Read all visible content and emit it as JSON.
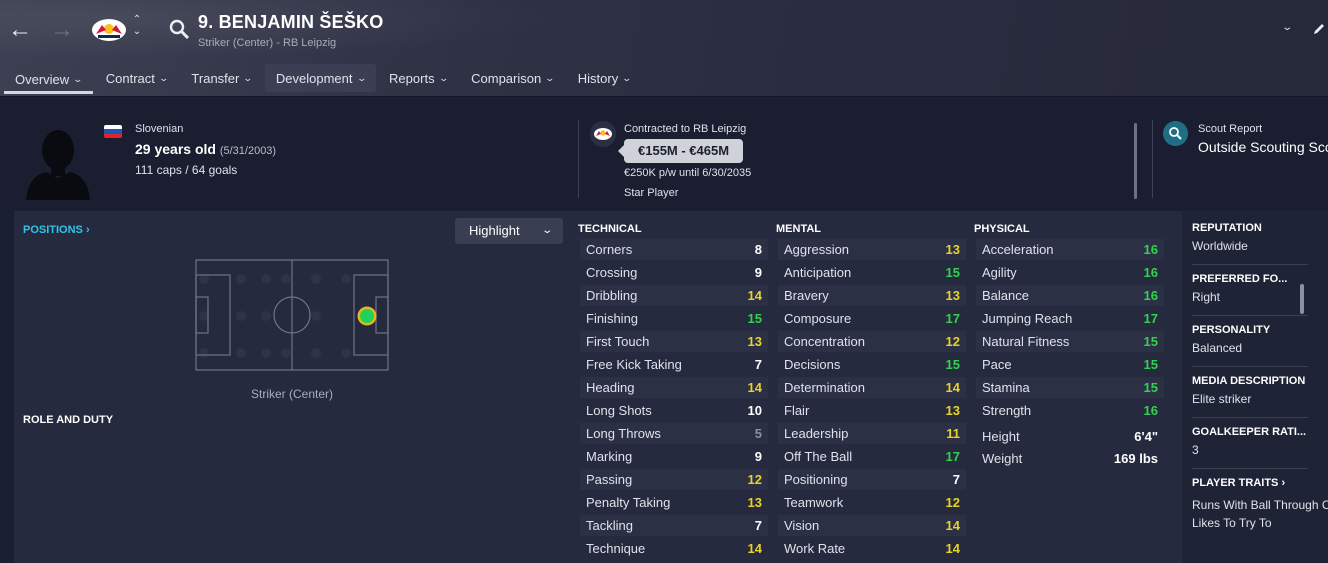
{
  "header": {
    "title": "9. BENJAMIN ŠEŠKO",
    "subtitle": "Striker (Center) - RB Leipzig",
    "tabs": [
      {
        "label": "Overview",
        "active": true
      },
      {
        "label": "Contract"
      },
      {
        "label": "Transfer"
      },
      {
        "label": "Development",
        "highlighted": true
      },
      {
        "label": "Reports"
      },
      {
        "label": "Comparison"
      },
      {
        "label": "History"
      }
    ]
  },
  "summary": {
    "nationality": "Slovenian",
    "age": "29 years old",
    "dob": "(5/31/2003)",
    "caps_goals": "111 caps / 64 goals",
    "contract_label": "Contracted to RB Leipzig",
    "value_range": "€155M - €465M",
    "wage_line": "€250K p/w until 6/30/2035",
    "status": "Star Player",
    "scout_label": "Scout Report",
    "scout_value": "Outside Scouting Scope"
  },
  "panel": {
    "positions_link": "POSITIONS ›",
    "highlight_label": "Highlight",
    "position_name": "Striker (Center)",
    "role_duty": "ROLE AND DUTY"
  },
  "attributes": {
    "technical": {
      "heading": "TECHNICAL",
      "rows": [
        {
          "name": "Corners",
          "value": "8"
        },
        {
          "name": "Crossing",
          "value": "9"
        },
        {
          "name": "Dribbling",
          "value": "14"
        },
        {
          "name": "Finishing",
          "value": "15"
        },
        {
          "name": "First Touch",
          "value": "13"
        },
        {
          "name": "Free Kick Taking",
          "value": "7"
        },
        {
          "name": "Heading",
          "value": "14"
        },
        {
          "name": "Long Shots",
          "value": "10"
        },
        {
          "name": "Long Throws",
          "value": "5"
        },
        {
          "name": "Marking",
          "value": "9"
        },
        {
          "name": "Passing",
          "value": "12"
        },
        {
          "name": "Penalty Taking",
          "value": "13"
        },
        {
          "name": "Tackling",
          "value": "7"
        },
        {
          "name": "Technique",
          "value": "14"
        }
      ]
    },
    "mental": {
      "heading": "MENTAL",
      "rows": [
        {
          "name": "Aggression",
          "value": "13"
        },
        {
          "name": "Anticipation",
          "value": "15"
        },
        {
          "name": "Bravery",
          "value": "13"
        },
        {
          "name": "Composure",
          "value": "17"
        },
        {
          "name": "Concentration",
          "value": "12"
        },
        {
          "name": "Decisions",
          "value": "15"
        },
        {
          "name": "Determination",
          "value": "14"
        },
        {
          "name": "Flair",
          "value": "13"
        },
        {
          "name": "Leadership",
          "value": "11"
        },
        {
          "name": "Off The Ball",
          "value": "17"
        },
        {
          "name": "Positioning",
          "value": "7"
        },
        {
          "name": "Teamwork",
          "value": "12"
        },
        {
          "name": "Vision",
          "value": "14"
        },
        {
          "name": "Work Rate",
          "value": "14"
        }
      ]
    },
    "physical": {
      "heading": "PHYSICAL",
      "rows": [
        {
          "name": "Acceleration",
          "value": "16"
        },
        {
          "name": "Agility",
          "value": "16"
        },
        {
          "name": "Balance",
          "value": "16"
        },
        {
          "name": "Jumping Reach",
          "value": "17"
        },
        {
          "name": "Natural Fitness",
          "value": "15"
        },
        {
          "name": "Pace",
          "value": "15"
        },
        {
          "name": "Stamina",
          "value": "15"
        },
        {
          "name": "Strength",
          "value": "16"
        }
      ],
      "extras": [
        {
          "name": "Height",
          "value": "6'4\""
        },
        {
          "name": "Weight",
          "value": "169 lbs"
        }
      ]
    }
  },
  "sidebar": {
    "reputation": {
      "label": "REPUTATION",
      "value": "Worldwide"
    },
    "preferred_foot": {
      "label": "PREFERRED FO...",
      "value": "Right"
    },
    "personality": {
      "label": "PERSONALITY",
      "value": "Balanced"
    },
    "media": {
      "label": "MEDIA DESCRIPTION",
      "value": "Elite striker"
    },
    "gk_rating": {
      "label": "GOALKEEPER RATI...",
      "value": "3"
    },
    "traits": {
      "label": "PLAYER TRAITS ›",
      "items": [
        "Runs With Ball Through Center",
        "Likes To Try To"
      ]
    }
  },
  "colors": {
    "white": "#ffffff",
    "grey": "#8c90a0",
    "yellow": "#e7d327",
    "green": "#33d14d",
    "accent": "#2fc5ea",
    "position_dot": "#1fd35a"
  },
  "icons": [
    "back-arrow-icon",
    "forward-arrow-icon",
    "club-crest-icon",
    "search-icon",
    "edit-icon",
    "slovenia-flag-icon",
    "scout-search-icon"
  ]
}
